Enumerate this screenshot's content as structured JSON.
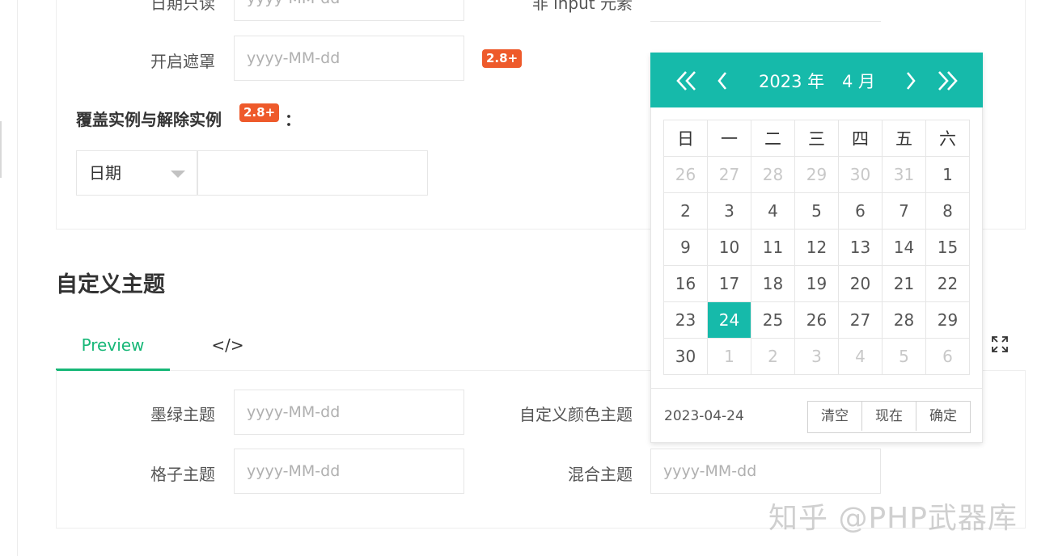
{
  "top_section": {
    "row0": {
      "label_left": "日期只读",
      "label_right": "非 input 元素"
    },
    "mask_row": {
      "label": "开启遮罩",
      "placeholder": "yyyy-MM-dd",
      "badge": "2.8+"
    },
    "cover_title": "覆盖实例与解除实例",
    "cover_badge": "2.8+",
    "cover_colon": "：",
    "select_value": "日期"
  },
  "custom_theme": {
    "title": "自定义主题",
    "tabs": [
      {
        "label": "Preview"
      },
      {
        "label": "</>"
      }
    ],
    "fields": [
      {
        "label": "墨绿主题",
        "placeholder": "yyyy-MM-dd"
      },
      {
        "label": "自定义颜色主题",
        "placeholder": ""
      },
      {
        "label": "格子主题",
        "placeholder": "yyyy-MM-dd"
      },
      {
        "label": "混合主题",
        "placeholder": "yyyy-MM-dd"
      }
    ]
  },
  "datepicker": {
    "year": "2023 年",
    "month": "4 月",
    "weekdays": [
      "日",
      "一",
      "二",
      "三",
      "四",
      "五",
      "六"
    ],
    "rows": [
      [
        "26",
        "27",
        "28",
        "29",
        "30",
        "31",
        "1"
      ],
      [
        "2",
        "3",
        "4",
        "5",
        "6",
        "7",
        "8"
      ],
      [
        "9",
        "10",
        "11",
        "12",
        "13",
        "14",
        "15"
      ],
      [
        "16",
        "17",
        "18",
        "19",
        "20",
        "21",
        "22"
      ],
      [
        "23",
        "24",
        "25",
        "26",
        "27",
        "28",
        "29"
      ],
      [
        "30",
        "1",
        "2",
        "3",
        "4",
        "5",
        "6"
      ]
    ],
    "selected_day": "24",
    "footer_date": "2023-04-24",
    "buttons": {
      "clear": "清空",
      "now": "现在",
      "confirm": "确定"
    },
    "accent_color": "#16baaa"
  },
  "icons": {
    "fullscreen": "fullscreen-icon"
  },
  "watermark": "知乎 @PHP武器库"
}
